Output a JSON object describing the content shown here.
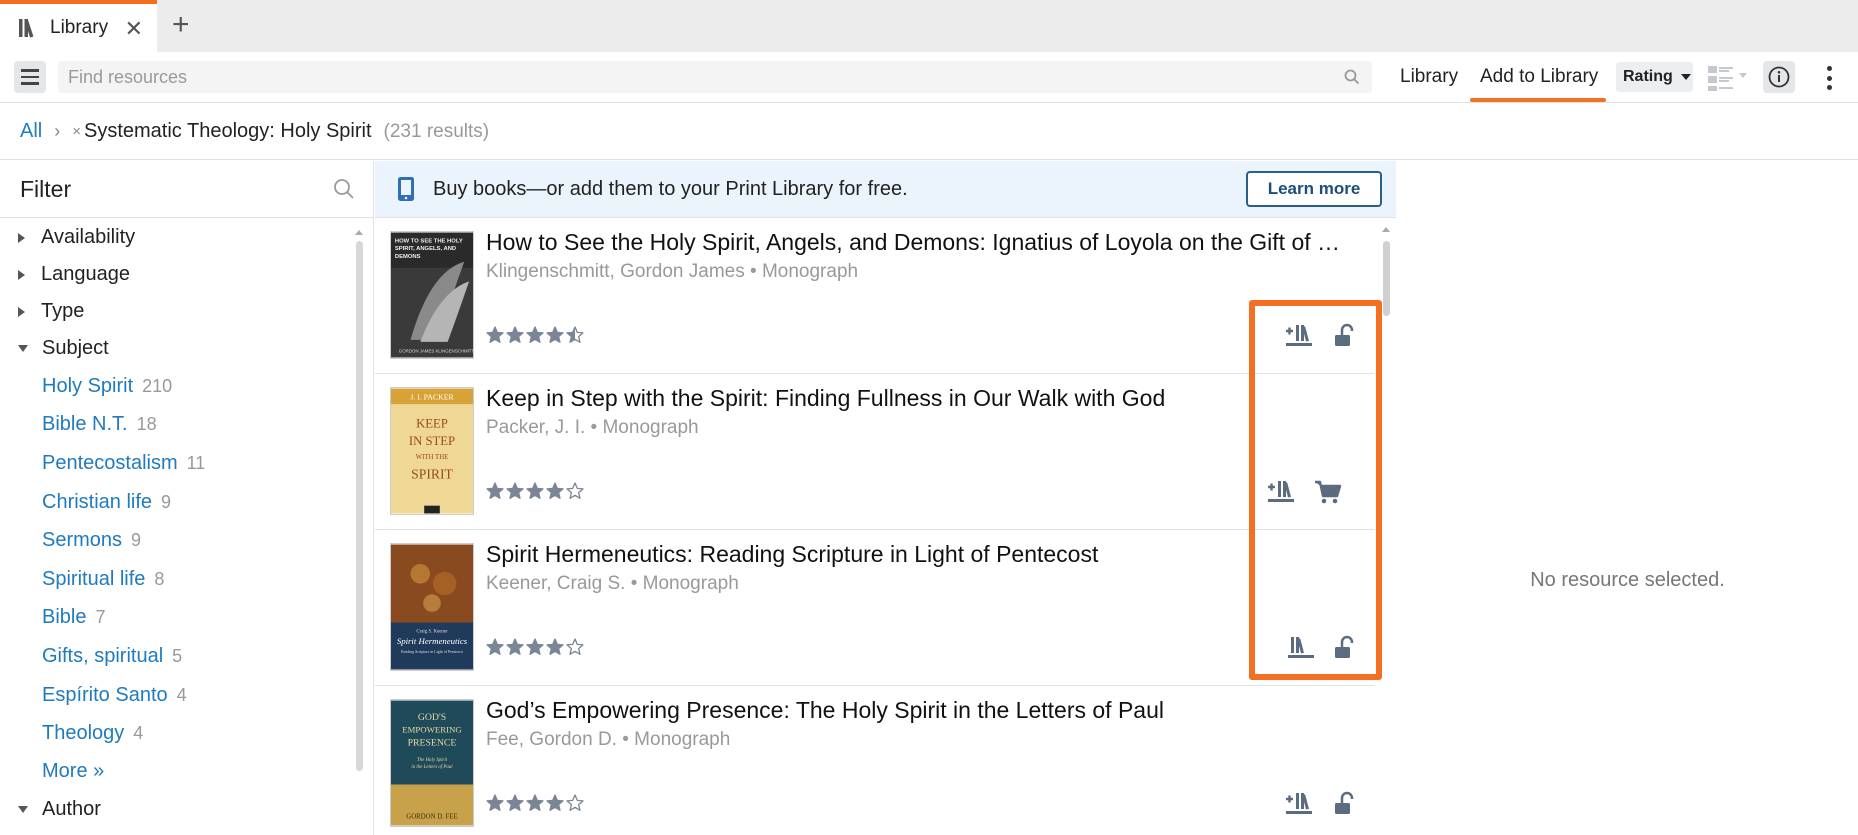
{
  "tab": {
    "title": "Library"
  },
  "toolbar": {
    "search_placeholder": "Find resources",
    "library_label": "Library",
    "add_label": "Add to Library",
    "sort_label": "Rating"
  },
  "breadcrumb": {
    "all": "All",
    "separator": "›",
    "remove": "×",
    "query": "Systematic Theology: Holy Spirit",
    "count": "(231 results)"
  },
  "filter": {
    "title": "Filter",
    "groups": [
      "Availability",
      "Language",
      "Type",
      "Subject"
    ],
    "subjects": [
      {
        "label": "Holy Spirit",
        "count": "210"
      },
      {
        "label": "Bible N.T.",
        "count": "18"
      },
      {
        "label": "Pentecostalism",
        "count": "11"
      },
      {
        "label": "Christian life",
        "count": "9"
      },
      {
        "label": "Sermons",
        "count": "9"
      },
      {
        "label": "Spiritual life",
        "count": "8"
      },
      {
        "label": "Bible",
        "count": "7"
      },
      {
        "label": "Gifts, spiritual",
        "count": "5"
      },
      {
        "label": "Espírito Santo",
        "count": "4"
      },
      {
        "label": "Theology",
        "count": "4"
      }
    ],
    "more": "More »",
    "author": "Author"
  },
  "promo": {
    "text": "Buy books—or add them to your Print Library for free.",
    "button": "Learn more"
  },
  "results": [
    {
      "title": "How to See the Holy Spirit, Angels, and Demons: Ignatius of Loyola on the Gift of Discernment",
      "author": "Klingenschmitt, Gordon James",
      "type": "Monograph",
      "rating": 4.5,
      "actions": [
        "add-to-print-library",
        "unlocked"
      ],
      "cover": {
        "text": "HOW TO SEE THE HOLY SPIRIT, ANGELS, AND DEMONS",
        "author": "GORDON JAMES KLINGENSCHMITT"
      }
    },
    {
      "title": "Keep in Step with the Spirit: Finding Fullness in Our Walk with God",
      "author": "Packer, J. I.",
      "type": "Monograph",
      "rating": 4,
      "actions": [
        "add-to-print-library",
        "cart"
      ],
      "cover": {
        "author": "J. I. PACKER",
        "l1": "KEEP",
        "l2": "IN STEP",
        "l3": "WITH THE",
        "l4": "SPIRIT"
      }
    },
    {
      "title": "Spirit Hermeneutics: Reading Scripture in Light of Pentecost",
      "author": "Keener, Craig S.",
      "type": "Monograph",
      "rating": 4,
      "actions": [
        "print-library",
        "unlocked"
      ],
      "cover": {
        "author": "Craig S. Keener",
        "l1": "Spirit Hermeneutics",
        "l2": "Reading Scripture in Light of Pentecost"
      }
    },
    {
      "title": "God’s Empowering Presence: The Holy Spirit in the Letters of Paul",
      "author": "Fee, Gordon D.",
      "type": "Monograph",
      "rating": 4,
      "actions": [
        "add-to-print-library",
        "unlocked"
      ],
      "cover": {
        "l1": "GOD'S",
        "l2": "EMPOWERING",
        "l3": "PRESENCE",
        "l4": "The Holy Spirit in the Letters of Paul",
        "author": "GORDON D. FEE"
      }
    }
  ],
  "meta_separator": "•",
  "detail": {
    "empty": "No resource selected."
  },
  "colors": {
    "accent": "#f36f21",
    "link": "#1f7bbf",
    "icon": "#5b6b80"
  }
}
